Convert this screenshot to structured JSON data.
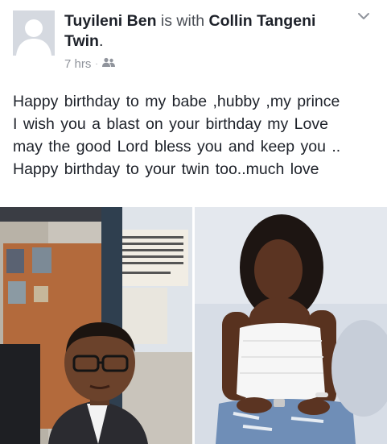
{
  "post": {
    "author": "Tuyileni Ben",
    "connector": " is with ",
    "tagged": "Collin Tangeni Twin",
    "tagged_suffix": ".",
    "time": "7 hrs",
    "separator": "·",
    "audience_icon": "friends-icon",
    "menu_icon": "chevron-down-icon",
    "message_lines": [
      "Happy  birthday  to  my babe ,hubby ,my prince",
      "I wish you  a blast  on your birthday  my Love",
      "may the good Lord bless you  and  keep you ..",
      "Happy  birthday  to  your twin too..much love"
    ]
  },
  "photos": {
    "left_desc_icon": "man-selfie-photo",
    "right_desc_icon": "woman-portrait-photo"
  },
  "colors": {
    "text": "#1d2129",
    "meta": "#90949c",
    "avatar_bg": "#d5d9e0"
  }
}
